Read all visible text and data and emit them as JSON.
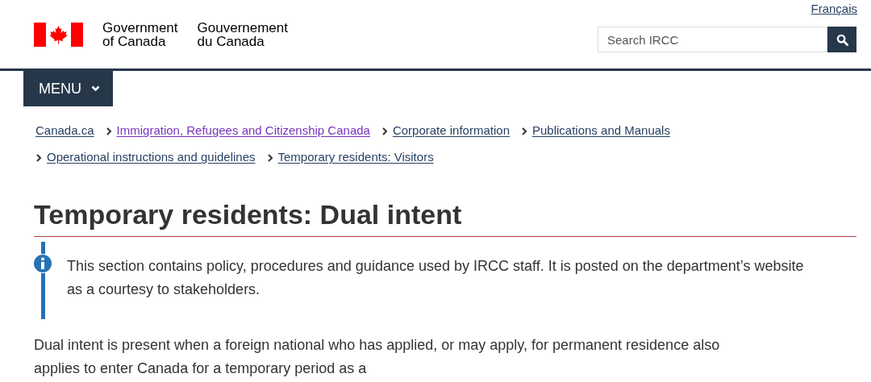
{
  "header": {
    "language_link": "Français",
    "signature_en": [
      "Government",
      "of Canada"
    ],
    "signature_fr": [
      "Gouvernement",
      "du Canada"
    ],
    "search": {
      "placeholder": "Search IRCC"
    }
  },
  "menu_button": {
    "label": "MENU"
  },
  "breadcrumbs": [
    {
      "label": "Canada.ca",
      "visited": false
    },
    {
      "label": "Immigration, Refugees and Citizenship Canada",
      "visited": true
    },
    {
      "label": "Corporate information",
      "visited": false
    },
    {
      "label": "Publications and Manuals",
      "visited": false
    },
    {
      "label": "Operational instructions and guidelines",
      "visited": false
    },
    {
      "label": "Temporary residents: Visitors",
      "visited": false
    }
  ],
  "title": "Temporary residents: Dual intent",
  "alert": {
    "text": "This section contains policy, procedures and guidance used by IRCC staff. It is posted on the department’s website as a courtesy to stakeholders."
  },
  "paragraph": "Dual intent is present when a foreign national who has applied, or may apply, for permanent residence also applies to enter Canada for a temporary period as a"
}
